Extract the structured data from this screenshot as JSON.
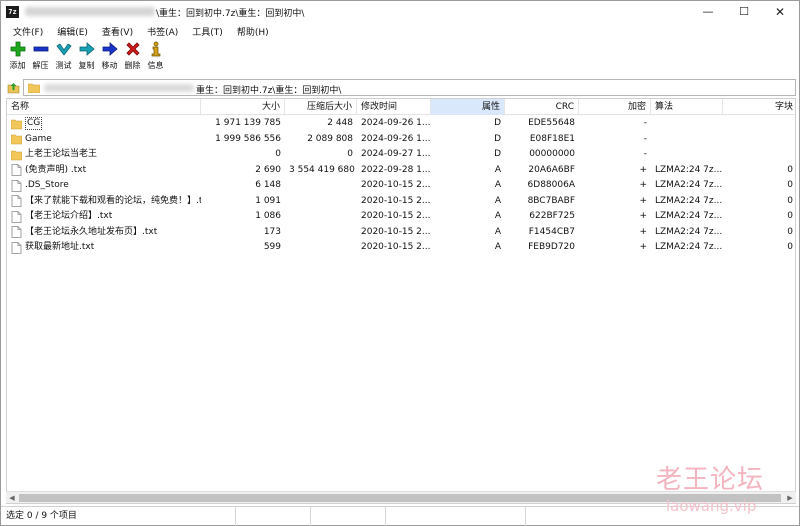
{
  "window": {
    "app_icon": "7z",
    "title": "\\重生：回到初中.7z\\重生：回到初中\\",
    "minimize": "—",
    "maximize": "☐",
    "close": "✕"
  },
  "menu": [
    {
      "label": "文件(F)"
    },
    {
      "label": "编辑(E)"
    },
    {
      "label": "查看(V)"
    },
    {
      "label": "书签(A)"
    },
    {
      "label": "工具(T)"
    },
    {
      "label": "帮助(H)"
    }
  ],
  "toolbar": [
    {
      "label": "添加",
      "icon": "plus-icon",
      "color": "#1ea81e"
    },
    {
      "label": "解压",
      "icon": "minus-icon",
      "color": "#1a33c8"
    },
    {
      "label": "测试",
      "icon": "check-icon",
      "color": "#1aa0b4"
    },
    {
      "label": "复制",
      "icon": "arrow-right-icon",
      "color": "#1aa0b4"
    },
    {
      "label": "移动",
      "icon": "arrow-right-icon",
      "color": "#1a33c8"
    },
    {
      "label": "删除",
      "icon": "delete-x-icon",
      "color": "#d01a1a"
    },
    {
      "label": "信息",
      "icon": "info-icon",
      "color": "#d4a017"
    }
  ],
  "address": {
    "path": "重生：回到初中.7z\\重生：回到初中\\"
  },
  "columns": [
    "名称",
    "大小",
    "压缩后大小",
    "修改时间",
    "属性",
    "CRC",
    "加密",
    "算法",
    "字块"
  ],
  "rows": [
    {
      "type": "folder",
      "name": "CG",
      "size": "1 971 139 785",
      "packed": "2 448",
      "modified": "2024-09-26 1...",
      "attr": "D",
      "crc": "EDE55648",
      "enc": "-",
      "method": "",
      "block": ""
    },
    {
      "type": "folder",
      "name": "Game",
      "size": "1 999 586 556",
      "packed": "2 089 808",
      "modified": "2024-09-26 1...",
      "attr": "D",
      "crc": "E08F18E1",
      "enc": "-",
      "method": "",
      "block": ""
    },
    {
      "type": "folder",
      "name": "上老王论坛当老王",
      "size": "0",
      "packed": "0",
      "modified": "2024-09-27 1...",
      "attr": "D",
      "crc": "00000000",
      "enc": "-",
      "method": "",
      "block": ""
    },
    {
      "type": "file",
      "name": "(免责声明) .txt",
      "size": "2 690",
      "packed": "3 554 419 680",
      "modified": "2022-09-28 1...",
      "attr": "A",
      "crc": "20A6A6BF",
      "enc": "+",
      "method": "LZMA2:24 7z...",
      "block": "0"
    },
    {
      "type": "file",
      "name": ".DS_Store",
      "size": "6 148",
      "packed": "",
      "modified": "2020-10-15 2...",
      "attr": "A",
      "crc": "6D88006A",
      "enc": "+",
      "method": "LZMA2:24 7z...",
      "block": "0"
    },
    {
      "type": "file",
      "name": "【来了就能下载和观看的论坛，纯免费！】.txt",
      "size": "1 091",
      "packed": "",
      "modified": "2020-10-15 2...",
      "attr": "A",
      "crc": "8BC7BABF",
      "enc": "+",
      "method": "LZMA2:24 7z...",
      "block": "0"
    },
    {
      "type": "file",
      "name": "【老王论坛介绍】.txt",
      "size": "1 086",
      "packed": "",
      "modified": "2020-10-15 2...",
      "attr": "A",
      "crc": "622BF725",
      "enc": "+",
      "method": "LZMA2:24 7z...",
      "block": "0"
    },
    {
      "type": "file",
      "name": "【老王论坛永久地址发布页】.txt",
      "size": "173",
      "packed": "",
      "modified": "2020-10-15 2...",
      "attr": "A",
      "crc": "F1454CB7",
      "enc": "+",
      "method": "LZMA2:24 7z...",
      "block": "0"
    },
    {
      "type": "file",
      "name": "获取最新地址.txt",
      "size": "599",
      "packed": "",
      "modified": "2020-10-15 2...",
      "attr": "A",
      "crc": "FEB9D720",
      "enc": "+",
      "method": "LZMA2:24 7z...",
      "block": "0"
    }
  ],
  "status": {
    "selection": "选定 0 / 9 个项目"
  },
  "watermark": {
    "main": "老王论坛",
    "sub": "laowang.vip"
  }
}
